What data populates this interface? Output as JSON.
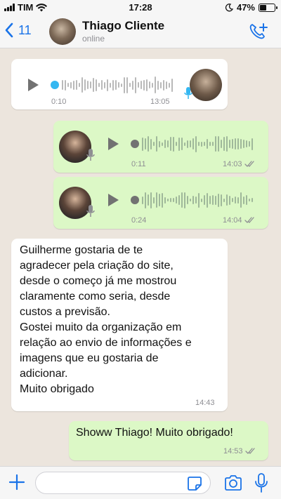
{
  "status_bar": {
    "carrier": "TIM",
    "time": "17:28",
    "battery": "47%",
    "battery_level": 0.47
  },
  "header": {
    "back_count": "11",
    "contact_name": "Thiago Cliente",
    "presence": "online"
  },
  "messages": [
    {
      "type": "voice",
      "direction": "incoming",
      "position": "0:10",
      "duration": "13:05",
      "progress": 0.0
    },
    {
      "type": "voice",
      "direction": "outgoing",
      "position": "0:11",
      "time": "14:03",
      "status": "read"
    },
    {
      "type": "voice",
      "direction": "outgoing",
      "position": "0:24",
      "time": "14:04",
      "status": "read"
    },
    {
      "type": "text",
      "direction": "incoming",
      "time": "14:43",
      "lines": [
        "Guilherme gostaria de te",
        "agradecer pela criação do site,",
        "desde o começo já me mostrou",
        "claramente como seria, desde",
        "custos a previsão.",
        "Gostei muito da organização em",
        "relação ao envio de informações e",
        "imagens que eu gostaria de",
        "adicionar.",
        "Muito obrigado"
      ]
    },
    {
      "type": "text",
      "direction": "outgoing",
      "text": "Showw Thiago! Muito obrigado!",
      "time": "14:53",
      "status": "read"
    }
  ],
  "input": {
    "placeholder": ""
  },
  "colors": {
    "chat_bg": "#ece5dd",
    "outgoing_bubble": "#dcf8c6",
    "incoming_bubble": "#ffffff",
    "accent_blue": "#1a73e8",
    "voice_dot_incoming": "#34b7f1",
    "read_ticks": "#8e8e93"
  },
  "icons": {
    "back": "chevron-left-icon",
    "add_call": "phone-plus-icon",
    "play": "play-icon",
    "mic": "microphone-icon",
    "plus": "plus-icon",
    "sticker": "sticker-icon",
    "camera": "camera-icon"
  }
}
